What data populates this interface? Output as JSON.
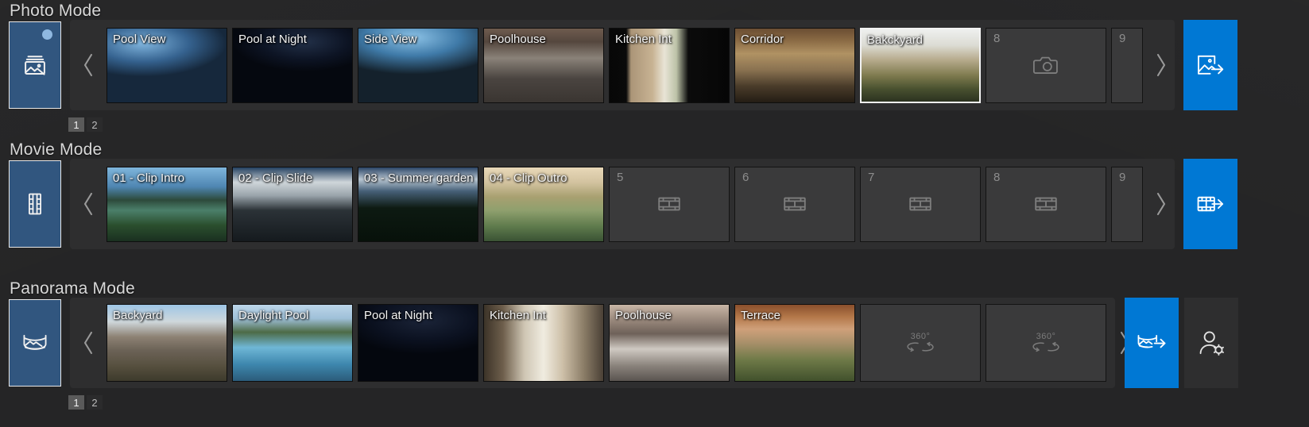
{
  "theme": {
    "accent_blue": "#0078d4",
    "mode_button_blue": "#31567f",
    "panel_bg": "#2e2e2f",
    "page_bg": "#252526",
    "slot_bg": "#3a3a3b"
  },
  "sections": [
    {
      "id": "photo",
      "title": "Photo Mode",
      "mode_icon": "photo-stack-icon",
      "prev_label": "‹",
      "next_label": "›",
      "action_icon": "image-export-icon",
      "empty_icon": "camera-icon",
      "items": [
        {
          "label": "Pool View",
          "art": "a-poolview",
          "selected": false
        },
        {
          "label": "Pool at Night",
          "art": "a-poolnight",
          "selected": false
        },
        {
          "label": "Side View",
          "art": "a-sideview",
          "selected": false
        },
        {
          "label": "Poolhouse",
          "art": "a-poolhouse",
          "selected": false
        },
        {
          "label": "Kitchen Int",
          "art": "a-kitchenint",
          "selected": false
        },
        {
          "label": "Corridor",
          "art": "a-corridor",
          "selected": false
        },
        {
          "label": "Bakckyard",
          "art": "a-backyard",
          "selected": true
        }
      ],
      "empty_slots": [
        {
          "number": "8",
          "clipped": false
        },
        {
          "number": "9",
          "clipped": true
        }
      ],
      "pages": [
        {
          "label": "1",
          "active": true
        },
        {
          "label": "2",
          "active": false
        }
      ]
    },
    {
      "id": "movie",
      "title": "Movie Mode",
      "mode_icon": "film-strip-icon",
      "prev_label": "‹",
      "next_label": "›",
      "action_icon": "film-export-icon",
      "empty_icon": "film-frame-icon",
      "items": [
        {
          "label": "01 - Clip Intro",
          "art": "a-clipintro",
          "selected": false
        },
        {
          "label": "02 - Clip Slide",
          "art": "a-clipslide",
          "selected": false
        },
        {
          "label": "03 - Summer garden",
          "art": "a-summergarden",
          "selected": false
        },
        {
          "label": "04 - Clip Outro",
          "art": "a-clipoutro",
          "selected": false
        }
      ],
      "empty_slots": [
        {
          "number": "5",
          "clipped": false
        },
        {
          "number": "6",
          "clipped": false
        },
        {
          "number": "7",
          "clipped": false
        },
        {
          "number": "8",
          "clipped": false
        },
        {
          "number": "9",
          "clipped": true
        }
      ],
      "pages": [
        {
          "label": "1",
          "active": true
        },
        {
          "label": "2",
          "active": false
        }
      ]
    },
    {
      "id": "panorama",
      "title": "Panorama Mode",
      "mode_icon": "panorama-icon",
      "prev_label": "‹",
      "next_label": "›",
      "action_icon": "panorama-export-icon",
      "secondary_action_icon": "user-settings-icon",
      "empty_icon": "360-icon",
      "empty_icon_label": "360°",
      "items": [
        {
          "label": "Backyard",
          "art": "a-pn-backyard",
          "selected": false
        },
        {
          "label": "Daylight Pool",
          "art": "a-pn-daylightpool",
          "selected": false
        },
        {
          "label": "Pool at Night",
          "art": "a-pn-poolnight",
          "selected": false
        },
        {
          "label": "Kitchen Int",
          "art": "a-pn-kitchenint",
          "selected": false
        },
        {
          "label": "Poolhouse",
          "art": "a-pn-poolhouse",
          "selected": false
        },
        {
          "label": "Terrace",
          "art": "a-pn-terrace",
          "selected": false
        }
      ],
      "empty_slots": [
        {
          "number": "",
          "clipped": false
        },
        {
          "number": "",
          "clipped": false
        }
      ],
      "pages": []
    }
  ]
}
